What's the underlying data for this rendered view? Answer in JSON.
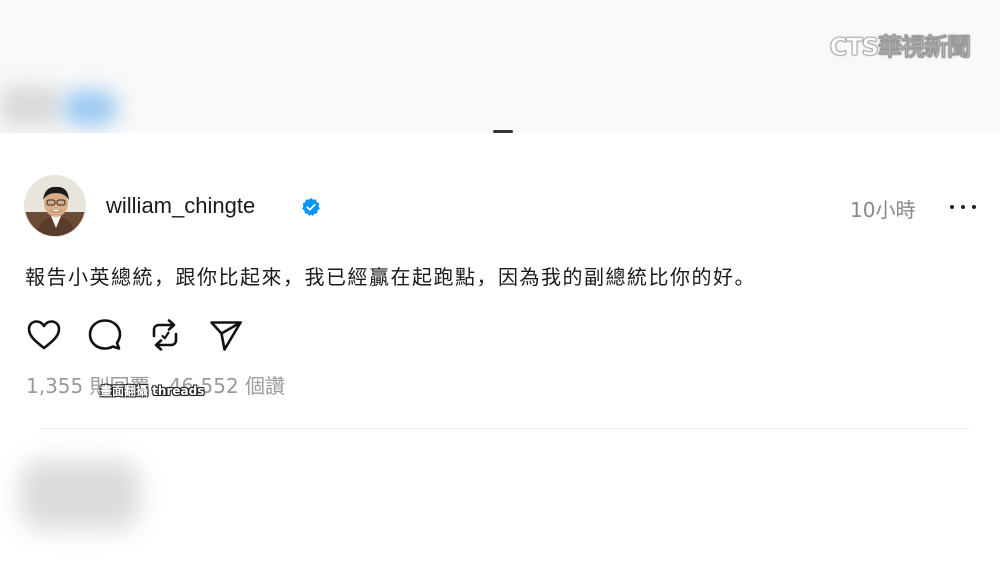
{
  "watermark": "CTS華視新聞",
  "post": {
    "username": "william_chingte",
    "verified_icon": "verified-badge-icon",
    "time": "10小時",
    "text": "報告小英總統，跟你比起來，我已經贏在起跑點，因為我的副總統比你的好。",
    "actions": [
      "heart-icon",
      "comment-icon",
      "repost-icon",
      "share-icon"
    ],
    "stats": "1,355 則回覆 · 46,552 個讚",
    "caption": "畫面翻攝 threads"
  },
  "colors": {
    "verified": "#0095f6",
    "muted": "#999999",
    "text": "#1a1a1a"
  }
}
